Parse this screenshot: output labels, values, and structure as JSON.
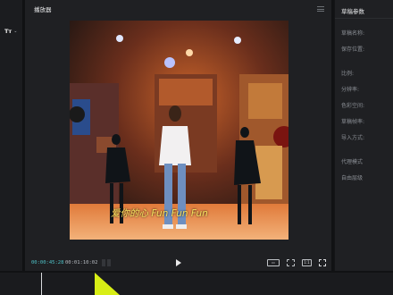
{
  "left_panel": {
    "text_tool_label": "Tт"
  },
  "player": {
    "title": "播放器",
    "subtitle": "爱你的心 Fun Fun Fun",
    "time_current": "00:00:45:28",
    "time_total": "00:01:10:02",
    "ratio_label": "1:1"
  },
  "side_panel": {
    "title": "草稿参数",
    "props": [
      "草稿名称:",
      "保存位置:",
      "比例:",
      "分辨率:",
      "色彩空间:",
      "草稿帧率:",
      "导入方式:",
      "代理模式",
      "自由层级"
    ]
  },
  "colors": {
    "accent": "#4fc3c8",
    "marker": "#d8ee16",
    "panel": "#1f2023"
  },
  "icons": [
    "menu-icon",
    "play-icon",
    "screen-icon",
    "snapshot-icon",
    "ratio-icon",
    "fullscreen-icon"
  ]
}
